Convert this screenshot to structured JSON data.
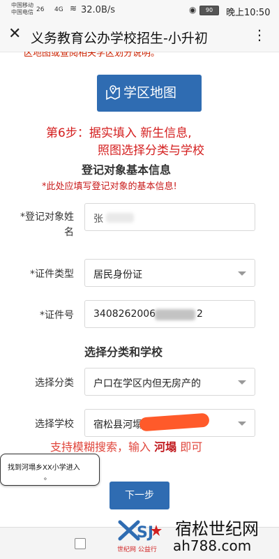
{
  "status_bar": {
    "carrier_1": "中国移动",
    "carrier_2": "中国电信",
    "signal_1": "26",
    "signal_2": "4G",
    "net_speed": "32.0B/s",
    "battery": "90",
    "time": "晚上10:50"
  },
  "header": {
    "close_glyph": "✕",
    "title": "义务教育公办学校招生-小升初",
    "more_glyph": "⋮"
  },
  "cut_off_text": "区地图或查阅相关学区划分说明。",
  "map_button": {
    "label": "学区地图",
    "icon": "map-pin-icon"
  },
  "step_note": {
    "line1": "第6步：据实填入 新生信息,",
    "line2": "照图选择分类与学校"
  },
  "section_basic": {
    "title": "登记对象基本信息",
    "hint": "*此处应填写登记对象的基本信息!"
  },
  "form": {
    "name_label_line1": "*登记对象姓",
    "name_label_line2": "名",
    "name_value": "张",
    "id_type_label": "*证件类型",
    "id_type_value": "居民身份证",
    "id_no_label": "*证件号",
    "id_no_value_start": "3408262006",
    "id_no_value_end": "2"
  },
  "section_school": {
    "title": "选择分类和学校",
    "category_label": "选择分类",
    "category_value": "户口在学区内但无房产的",
    "school_label": "选择学校",
    "school_value": "宿松县河塌"
  },
  "fuzzy_note": {
    "prefix": "支持模糊搜索，输入 ",
    "keyword": "河塌",
    "suffix": " 即可"
  },
  "tooltip": {
    "line1": "找到河塌乡XX小学进入",
    "line2": "。"
  },
  "next_button": "下一步",
  "watermark": {
    "logo_text": "SJ",
    "sub_text": "世纪网 公益行",
    "site_name": "宿松世纪网",
    "url": "ah788.com"
  },
  "colors": {
    "accent_blue": "#2f6cb2",
    "alert_red": "#d41f1f",
    "redaction_orange": "#ff5a2a"
  }
}
